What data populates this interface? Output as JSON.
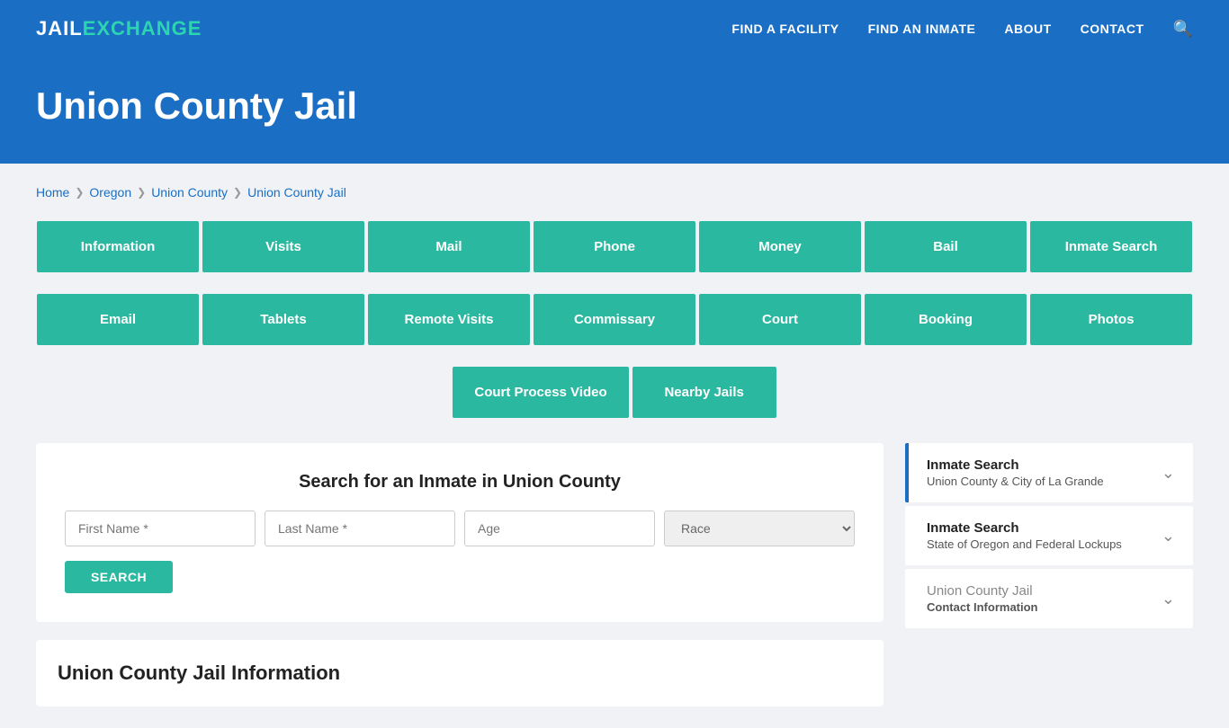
{
  "header": {
    "logo_jail": "JAIL",
    "logo_exchange": "EXCHANGE",
    "nav": [
      {
        "label": "FIND A FACILITY",
        "id": "find-facility"
      },
      {
        "label": "FIND AN INMATE",
        "id": "find-inmate"
      },
      {
        "label": "ABOUT",
        "id": "about"
      },
      {
        "label": "CONTACT",
        "id": "contact"
      }
    ],
    "search_icon": "&#128269;"
  },
  "hero": {
    "title": "Union County Jail"
  },
  "breadcrumb": {
    "items": [
      {
        "label": "Home",
        "active": true
      },
      {
        "label": "Oregon",
        "active": true
      },
      {
        "label": "Union County",
        "active": true
      },
      {
        "label": "Union County Jail",
        "active": true
      }
    ]
  },
  "buttons_row1": [
    {
      "label": "Information"
    },
    {
      "label": "Visits"
    },
    {
      "label": "Mail"
    },
    {
      "label": "Phone"
    },
    {
      "label": "Money"
    },
    {
      "label": "Bail"
    },
    {
      "label": "Inmate Search"
    }
  ],
  "buttons_row2": [
    {
      "label": "Email"
    },
    {
      "label": "Tablets"
    },
    {
      "label": "Remote Visits"
    },
    {
      "label": "Commissary"
    },
    {
      "label": "Court"
    },
    {
      "label": "Booking"
    },
    {
      "label": "Photos"
    }
  ],
  "buttons_row3": [
    {
      "label": "Court Process Video"
    },
    {
      "label": "Nearby Jails"
    }
  ],
  "search_section": {
    "title": "Search for an Inmate in Union County",
    "first_name_placeholder": "First Name *",
    "last_name_placeholder": "Last Name *",
    "age_placeholder": "Age",
    "race_placeholder": "Race",
    "search_button": "SEARCH"
  },
  "info_section": {
    "title": "Union County Jail Information"
  },
  "sidebar": {
    "cards": [
      {
        "title": "Inmate Search",
        "sub": "Union County & City of La Grande",
        "active": true,
        "grayed": false
      },
      {
        "title": "Inmate Search",
        "sub": "State of Oregon and Federal Lockups",
        "active": false,
        "grayed": false
      },
      {
        "title": "Union County Jail",
        "sub": "Contact Information",
        "active": false,
        "grayed": true
      }
    ]
  }
}
